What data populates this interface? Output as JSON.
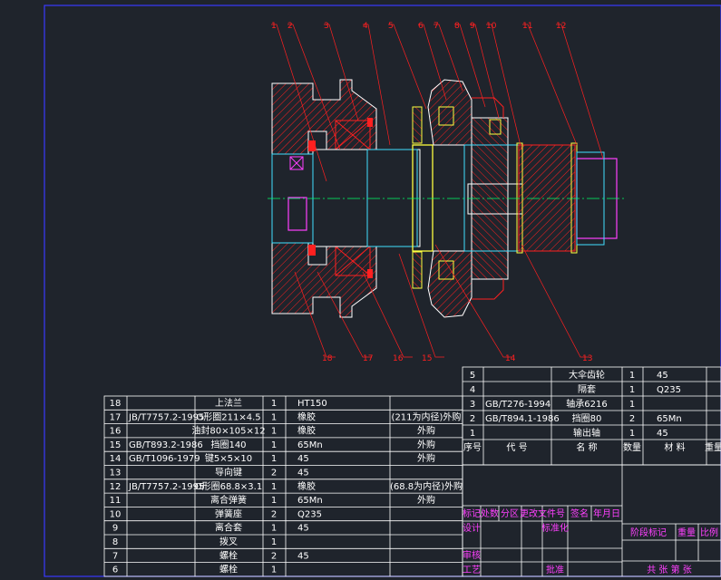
{
  "callouts": [
    "1",
    "2",
    "3",
    "4",
    "5",
    "6",
    "7",
    "8",
    "9",
    "10",
    "11",
    "12",
    "13",
    "14",
    "15",
    "16",
    "17",
    "18"
  ],
  "parts_left": [
    {
      "no": "18",
      "code": "",
      "name": "上法兰",
      "qty": "1",
      "material": "HT150",
      "note": ""
    },
    {
      "no": "17",
      "code": "JB/T7757.2-1995",
      "name": "O形圈211×4.5",
      "qty": "1",
      "material": "橡胶",
      "note": "(211为内径)外购"
    },
    {
      "no": "16",
      "code": "",
      "name": "油封80×105×12",
      "qty": "1",
      "material": "橡胶",
      "note": "外购"
    },
    {
      "no": "15",
      "code": "GB/T893.2-1986",
      "name": "挡圈140",
      "qty": "1",
      "material": "65Mn",
      "note": "外购"
    },
    {
      "no": "14",
      "code": "GB/T1096-1979",
      "name": "键5×5×10",
      "qty": "1",
      "material": "45",
      "note": "外购"
    },
    {
      "no": "13",
      "code": "",
      "name": "导向键",
      "qty": "2",
      "material": "45",
      "note": ""
    },
    {
      "no": "12",
      "code": "JB/T7757.2-1995",
      "name": "O形圈68.8×3.1",
      "qty": "1",
      "material": "橡胶",
      "note": "(68.8为内径)外购"
    },
    {
      "no": "11",
      "code": "",
      "name": "离合弹簧",
      "qty": "1",
      "material": "65Mn",
      "note": "外购"
    },
    {
      "no": "10",
      "code": "",
      "name": "弹簧座",
      "qty": "2",
      "material": "Q235",
      "note": ""
    },
    {
      "no": "9",
      "code": "",
      "name": "离合套",
      "qty": "1",
      "material": "45",
      "note": ""
    },
    {
      "no": "8",
      "code": "",
      "name": "拨叉",
      "qty": "1",
      "material": "",
      "note": ""
    },
    {
      "no": "7",
      "code": "",
      "name": "螺栓",
      "qty": "2",
      "material": "45",
      "note": ""
    },
    {
      "no": "6",
      "code": "",
      "name": "螺栓",
      "qty": "1",
      "material": "",
      "note": ""
    }
  ],
  "parts_right": [
    {
      "no": "5",
      "code": "",
      "name": "大伞齿轮",
      "qty": "1",
      "material": "45"
    },
    {
      "no": "4",
      "code": "",
      "name": "隔套",
      "qty": "1",
      "material": "Q235"
    },
    {
      "no": "3",
      "code": "GB/T276-1994",
      "name": "轴承6216",
      "qty": "1",
      "material": ""
    },
    {
      "no": "2",
      "code": "GB/T894.1-1986",
      "name": "挡圈80",
      "qty": "2",
      "material": "65Mn"
    },
    {
      "no": "1",
      "code": "",
      "name": "输出轴",
      "qty": "1",
      "material": "45"
    }
  ],
  "header_row": {
    "no": "序号",
    "code": "代    号",
    "name": "名    称",
    "qty": "数量",
    "material": "材    料",
    "weight": "重量"
  },
  "title_block": {
    "row1": [
      "标记",
      "处数",
      "分区",
      "更改文件号",
      "签名",
      "年月日"
    ],
    "row2": [
      "设计",
      "",
      "",
      "标准化",
      ""
    ],
    "row3": [
      "审核",
      ""
    ],
    "row4": [
      "工艺",
      "",
      "批准"
    ],
    "stage": "阶段标记",
    "weight": "重量",
    "scale": "比例",
    "sheets": "共    张  第    张"
  },
  "colors": {
    "background": "#1f242c",
    "section": "#ff2020",
    "outline": "#ffffff",
    "center": "#00ff66",
    "yellow": "#ffff40",
    "magenta": "#ff40ff",
    "cyan": "#40e0ff"
  }
}
